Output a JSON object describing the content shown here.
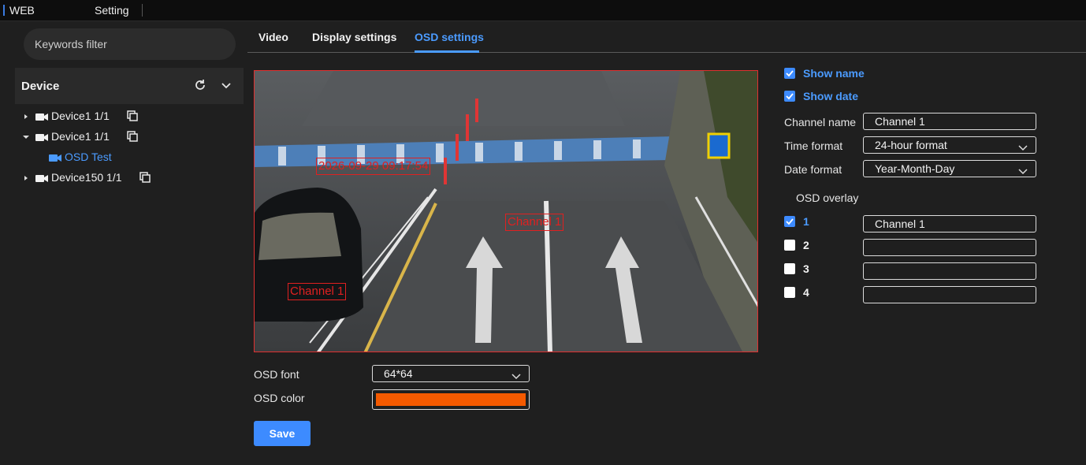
{
  "topbar": {
    "brand": "WEB",
    "menu": "Setting"
  },
  "sidebar": {
    "search_placeholder": "Keywords filter",
    "device_title": "Device",
    "tree": [
      {
        "label": "Device1 1/1",
        "expanded": false
      },
      {
        "label": "Device1 1/1",
        "expanded": true
      },
      {
        "label": "OSD Test",
        "child": true
      },
      {
        "label": "Device150 1/1",
        "expanded": false
      }
    ]
  },
  "tabs": [
    {
      "label": "Video",
      "active": false
    },
    {
      "label": "Display settings",
      "active": false
    },
    {
      "label": "OSD settings",
      "active": true
    }
  ],
  "preview": {
    "osd_date": "2026-09-29 09:17:54",
    "osd_channel_center": "Channel 1",
    "osd_channel_left": "Channel 1",
    "osd_color": "#e02020"
  },
  "osd_font": {
    "label": "OSD font",
    "value": "64*64"
  },
  "osd_color": {
    "label": "OSD color",
    "value": "#f55a00"
  },
  "save_label": "Save",
  "right": {
    "show_name": {
      "label": "Show name",
      "checked": true
    },
    "show_date": {
      "label": "Show date",
      "checked": true
    },
    "channel_name": {
      "label": "Channel name",
      "value": "Channel 1"
    },
    "time_format": {
      "label": "Time format",
      "value": "24-hour format"
    },
    "date_format": {
      "label": "Date format",
      "value": "Year-Month-Day"
    },
    "overlay_title": "OSD overlay",
    "overlays": [
      {
        "num": "1",
        "checked": true,
        "value": "Channel 1"
      },
      {
        "num": "2",
        "checked": false,
        "value": ""
      },
      {
        "num": "3",
        "checked": false,
        "value": ""
      },
      {
        "num": "4",
        "checked": false,
        "value": ""
      }
    ]
  },
  "colors": {
    "accent": "#4b9bff",
    "button": "#3d8bff",
    "osd_red": "#e02020",
    "background": "#1f1f1f"
  }
}
